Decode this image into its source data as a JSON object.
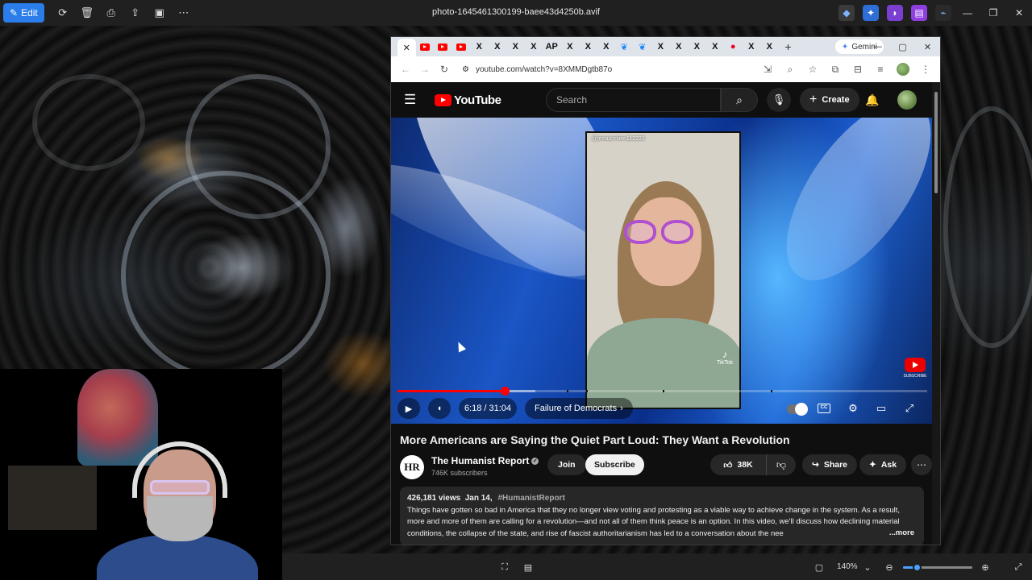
{
  "viewer": {
    "edit_label": "Edit",
    "file_title": "photo-1645461300199-baee43d4250b.avif",
    "toolbar_icons": [
      "rotate-icon",
      "delete-icon",
      "print-icon",
      "share-icon",
      "slideshow-icon",
      "more-icon"
    ],
    "zoom_value": "140%",
    "zoom_level_fraction": 0.2
  },
  "browser": {
    "url": "youtube.com/watch?v=8XMMDgtb87o",
    "gemini_label": "Gemini",
    "tabs": [
      "youtube",
      "youtube",
      "youtube",
      "x",
      "x",
      "x",
      "x",
      "ap",
      "x",
      "x",
      "x",
      "bluesky",
      "bluesky",
      "x",
      "x",
      "x",
      "x",
      "pinterest",
      "x",
      "x"
    ]
  },
  "youtube": {
    "logo_text": "YouTube",
    "search_placeholder": "Search",
    "create_label": "Create",
    "brand_color": "#ff0000",
    "player": {
      "current_time": "6:18",
      "duration": "31:04",
      "time_text": "6:18 / 31:04",
      "chapter": "Failure of Democrats",
      "progress_fraction": 0.2027,
      "buffered_fraction": 0.26,
      "tiktok_handle": "@jeeaanniiee112233",
      "tiktok_label": "TikTok",
      "subscribe_watermark": "SUBSCRIBE"
    },
    "video": {
      "title": "More Americans are Saying the Quiet Part Loud: They Want a Revolution",
      "channel_name": "The Humanist Report",
      "channel_initials": "HR",
      "subscribers": "746K subscribers",
      "join_label": "Join",
      "subscribe_label": "Subscribe",
      "likes": "38K",
      "share_label": "Share",
      "ask_label": "Ask",
      "views": "426,181 views",
      "date": "Jan 14,",
      "hashtag": "#HumanistReport",
      "description": "Things have gotten so bad in America that they no longer view voting and protesting as a viable way to achieve change in the system. As a result, more and more of them are calling for a revolution—and not all of them think peace is an option. In this video, we'll discuss how declining material conditions, the collapse of the state, and rise of fascist authoritarianism has led to a conversation about the nee",
      "more_label": "...more"
    }
  }
}
